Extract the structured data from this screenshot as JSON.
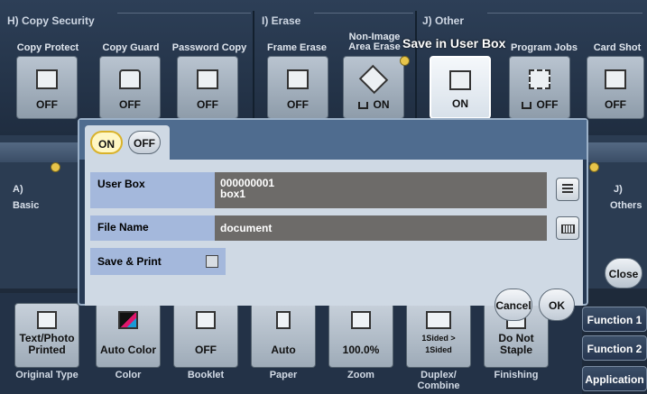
{
  "groups": {
    "copy_security": "H)  Copy Security",
    "erase": "I)  Erase",
    "other": "J)  Other"
  },
  "functions": [
    {
      "label": "Copy Protect",
      "value": "OFF",
      "icon": "copy-protect-icon"
    },
    {
      "label": "Copy Guard",
      "value": "OFF",
      "icon": "copy-guard-icon"
    },
    {
      "label": "Password Copy",
      "value": "OFF",
      "icon": "password-copy-icon"
    },
    {
      "label": "Frame Erase",
      "value": "OFF",
      "icon": "frame-erase-icon"
    },
    {
      "label": "Non-Image\nArea Erase",
      "value": "ON",
      "icon": "non-image-erase-icon"
    },
    {
      "label": "",
      "value": "ON",
      "icon": "save-user-box-icon"
    },
    {
      "label": "Program Jobs",
      "value": "OFF",
      "icon": "program-jobs-icon"
    },
    {
      "label": "Card Shot",
      "value": "OFF",
      "icon": "card-shot-icon"
    }
  ],
  "callout": "Save in User Box",
  "side": {
    "basic_letter": "A)",
    "basic": "Basic",
    "others_letter": "J)",
    "others": "Others",
    "close": "Close"
  },
  "modal": {
    "on": "ON",
    "off": "OFF",
    "user_box_label": "User Box",
    "user_box_number": "000000001",
    "user_box_name": "box1",
    "file_name_label": "File Name",
    "file_name_value": "document",
    "save_print_label": "Save & Print",
    "cancel": "Cancel",
    "ok": "OK"
  },
  "basic_items": [
    {
      "value": "Text/Photo\nPrinted",
      "caption": "Original Type",
      "icon": "original-type-icon"
    },
    {
      "value": "Auto Color",
      "caption": "Color",
      "icon": "color-icon"
    },
    {
      "value": "OFF",
      "caption": "Booklet",
      "icon": "booklet-icon"
    },
    {
      "value": "Auto",
      "caption": "Paper",
      "icon": "paper-icon"
    },
    {
      "value": "100.0%",
      "caption": "Zoom",
      "icon": "zoom-icon"
    },
    {
      "value": "1Sided > 1Sided",
      "caption": "Duplex/\nCombine",
      "icon": "duplex-icon"
    },
    {
      "value": "Do Not\nStaple",
      "caption": "Finishing",
      "icon": "finishing-icon"
    }
  ],
  "side_functions": [
    "Function 1",
    "Function 2",
    "Application"
  ]
}
